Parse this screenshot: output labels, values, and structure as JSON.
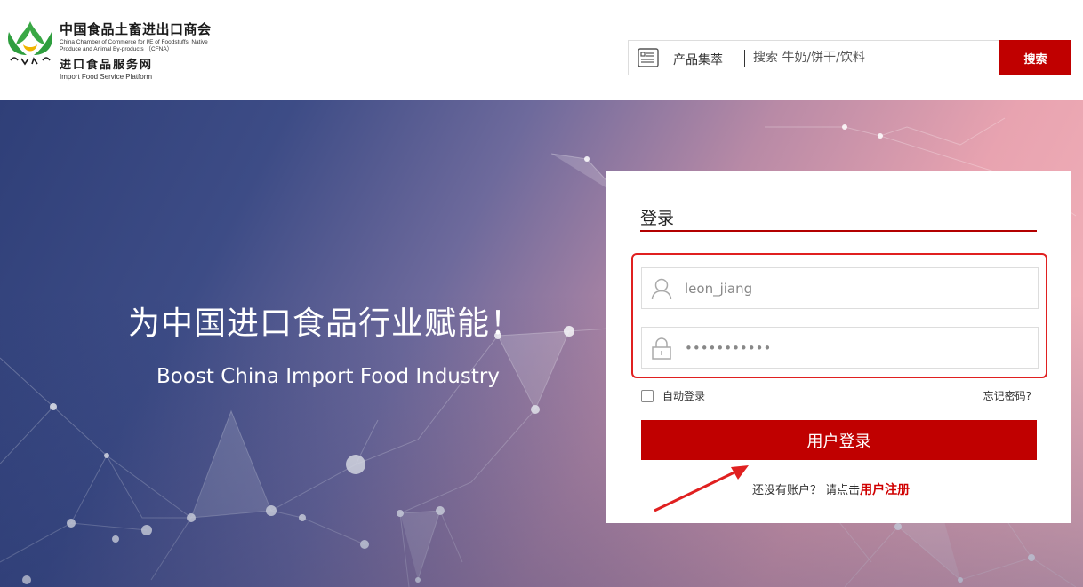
{
  "header": {
    "org_name_cn": "中国食品土畜进出口商会",
    "org_name_en": "China Chamber of Commerce for I/E of Foodstuffs, Native Produce and Animal By-products （CFNA）",
    "platform_cn": "进口食品服务网",
    "platform_en": "Import Food Service Platform",
    "logo_letters": "CFNA",
    "logo_icon": "cfna-logo-icon"
  },
  "search": {
    "category_label": "产品集萃",
    "category_icon": "list-document-icon",
    "placeholder": "搜索 牛奶/饼干/饮料",
    "button_label": "搜索"
  },
  "banner": {
    "slogan_cn": "为中国进口食品行业赋能！",
    "slogan_en": "Boost China Import Food Industry"
  },
  "login": {
    "title": "登录",
    "username_value": "leon_jiang",
    "username_icon": "user-icon",
    "password_value": "•••••••••••",
    "password_icon": "lock-icon",
    "remember_label": "自动登录",
    "remember_checked": false,
    "forgot_label": "忘记密码?",
    "submit_label": "用户登录",
    "register_prompt": "还没有账户？ 请点击",
    "register_link": "用户注册"
  },
  "colors": {
    "brand_red": "#c00000",
    "highlight_red": "#e02020",
    "logo_green": "#3aa845",
    "logo_yellow": "#f0b400"
  }
}
